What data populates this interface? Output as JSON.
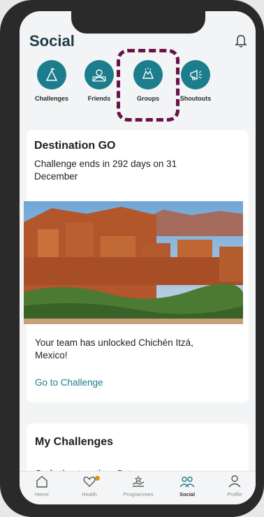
{
  "header": {
    "title": "Social"
  },
  "tabs": [
    {
      "label": "Challenges",
      "icon": "flag-icon"
    },
    {
      "label": "Friends",
      "icon": "friends-icon"
    },
    {
      "label": "Groups",
      "icon": "high-five-icon"
    },
    {
      "label": "Shoutouts",
      "icon": "megaphone-icon"
    }
  ],
  "challenge_card": {
    "title": "Destination GO",
    "subtitle": "Challenge ends in 292 days on 31 December",
    "unlock_text": "Your team has unlocked Chichén Itzá, Mexico!",
    "link_text": "Go to Challenge"
  },
  "my_challenges": {
    "title": "My Challenges",
    "subtitle": "Go further together. Get"
  },
  "bottom_nav": [
    {
      "label": "Home",
      "icon": "home-icon"
    },
    {
      "label": "Health",
      "icon": "heart-icon"
    },
    {
      "label": "Programmes",
      "icon": "hands-icon"
    },
    {
      "label": "Social",
      "icon": "people-icon",
      "active": true
    },
    {
      "label": "Profile",
      "icon": "person-icon"
    }
  ],
  "colors": {
    "accent": "#1c7d8c",
    "highlight": "#6a1148",
    "notification": "#e88a1a"
  }
}
